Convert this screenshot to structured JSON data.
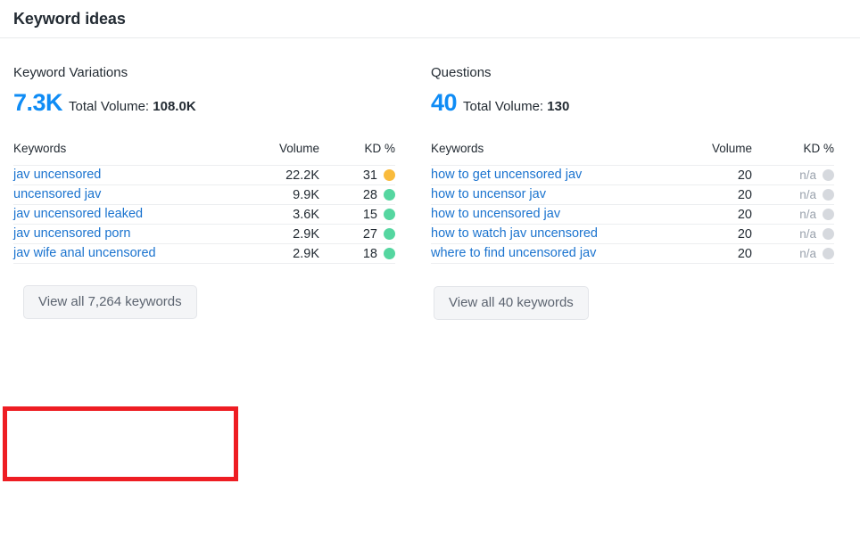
{
  "header": {
    "title": "Keyword ideas"
  },
  "colors": {
    "accent_blue": "#0f8cf5",
    "link_blue": "#1a73cf",
    "kd_easy_green": "#55d6a0",
    "kd_medium_orange": "#f9bb3c",
    "kd_na_gray": "#d6d9de",
    "highlight_red": "#ee1d23"
  },
  "panels": [
    {
      "label": "Keyword Variations",
      "count": "7.3K",
      "total_volume_label": "Total Volume:",
      "total_volume_value": "108.0K",
      "columns": {
        "keywords": "Keywords",
        "volume": "Volume",
        "kd": "KD %"
      },
      "rows": [
        {
          "keyword": "jav uncensored",
          "volume": "22.2K",
          "kd": "31",
          "kd_dot": "#f9bb3c"
        },
        {
          "keyword": "uncensored jav",
          "volume": "9.9K",
          "kd": "28",
          "kd_dot": "#55d6a0"
        },
        {
          "keyword": "jav uncensored leaked",
          "volume": "3.6K",
          "kd": "15",
          "kd_dot": "#55d6a0"
        },
        {
          "keyword": "jav uncensored porn",
          "volume": "2.9K",
          "kd": "27",
          "kd_dot": "#55d6a0"
        },
        {
          "keyword": "jav wife anal uncensored",
          "volume": "2.9K",
          "kd": "18",
          "kd_dot": "#55d6a0"
        }
      ],
      "view_all_label": "View all 7,264 keywords",
      "highlighted": true
    },
    {
      "label": "Questions",
      "count": "40",
      "total_volume_label": "Total Volume:",
      "total_volume_value": "130",
      "columns": {
        "keywords": "Keywords",
        "volume": "Volume",
        "kd": "KD %"
      },
      "rows": [
        {
          "keyword": "how to get uncensored jav",
          "volume": "20",
          "kd": "n/a",
          "kd_dot": "#d6d9de"
        },
        {
          "keyword": "how to uncensor jav",
          "volume": "20",
          "kd": "n/a",
          "kd_dot": "#d6d9de"
        },
        {
          "keyword": "how to uncensored jav",
          "volume": "20",
          "kd": "n/a",
          "kd_dot": "#d6d9de"
        },
        {
          "keyword": "how to watch jav uncensored",
          "volume": "20",
          "kd": "n/a",
          "kd_dot": "#d6d9de"
        },
        {
          "keyword": "where to find uncensored jav",
          "volume": "20",
          "kd": "n/a",
          "kd_dot": "#d6d9de"
        }
      ],
      "view_all_label": "View all 40 keywords",
      "highlighted": false
    }
  ]
}
